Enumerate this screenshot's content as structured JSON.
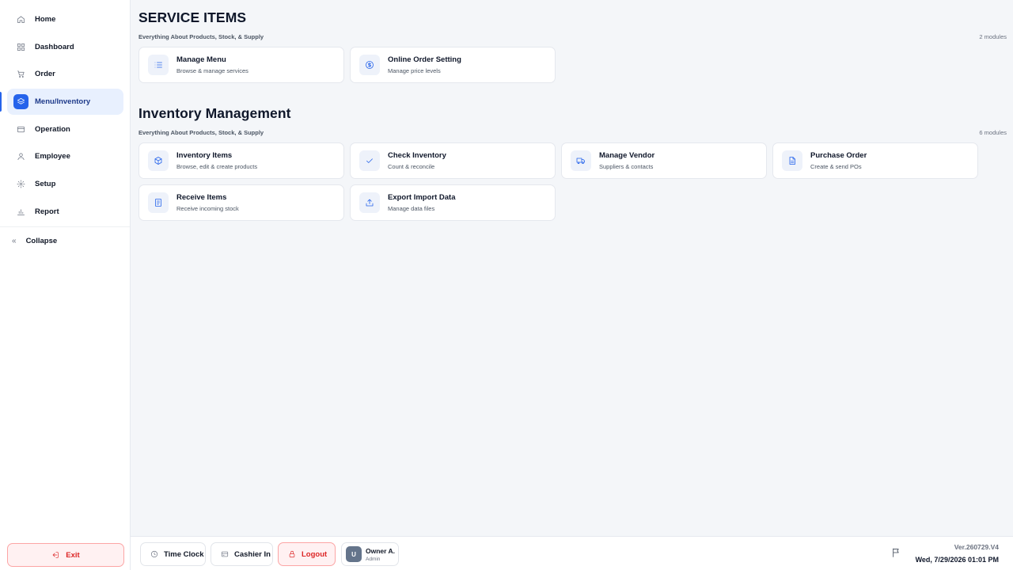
{
  "sidebar": {
    "items": [
      {
        "label": "Home",
        "icon": "home-icon"
      },
      {
        "label": "Dashboard",
        "icon": "dashboard-icon"
      },
      {
        "label": "Order",
        "icon": "cart-icon"
      },
      {
        "label": "Menu/Inventory",
        "icon": "layers-icon",
        "active": true
      },
      {
        "label": "Operation",
        "icon": "card-icon"
      },
      {
        "label": "Employee",
        "icon": "user-icon"
      },
      {
        "label": "Setup",
        "icon": "gear-icon"
      },
      {
        "label": "Report",
        "icon": "bar-chart-icon"
      }
    ],
    "collapse_label": "Collapse",
    "exit_label": "Exit"
  },
  "sections": [
    {
      "title": "SERVICE ITEMS",
      "subtitle": "Everything About Products, Stock, & Supply",
      "count": "2 modules",
      "cards": [
        {
          "title": "Manage Menu",
          "subtitle": "Browse & manage services",
          "icon": "list-icon"
        },
        {
          "title": "Online Order Setting",
          "subtitle": "Manage price levels",
          "icon": "dollar-icon"
        }
      ]
    },
    {
      "title": "Inventory Management",
      "subtitle": "Everything About Products, Stock, & Supply",
      "count": "6 modules",
      "cards": [
        {
          "title": "Inventory Items",
          "subtitle": "Browse, edit & create products",
          "icon": "box-icon"
        },
        {
          "title": "Check Inventory",
          "subtitle": "Count & reconcile",
          "icon": "check-icon"
        },
        {
          "title": "Manage Vendor",
          "subtitle": "Suppliers & contacts",
          "icon": "truck-icon"
        },
        {
          "title": "Purchase Order",
          "subtitle": "Create & send POs",
          "icon": "document-icon"
        },
        {
          "title": "Receive Items",
          "subtitle": "Receive incoming stock",
          "icon": "receipt-icon"
        },
        {
          "title": "Export Import Data",
          "subtitle": "Manage data files",
          "icon": "upload-icon"
        }
      ]
    }
  ],
  "footer": {
    "time_clock_label": "Time Clock",
    "cashier_in_label": "Cashier In",
    "logout_label": "Logout",
    "user": {
      "initial": "U",
      "name": "Owner A.",
      "role": "Admin"
    },
    "version": "Ver.260729.V4",
    "datetime": "Wed, 7/29/2026 01:01 PM"
  },
  "colors": {
    "accent": "#2563eb",
    "danger": "#dc2626",
    "background": "#f4f6f9"
  }
}
